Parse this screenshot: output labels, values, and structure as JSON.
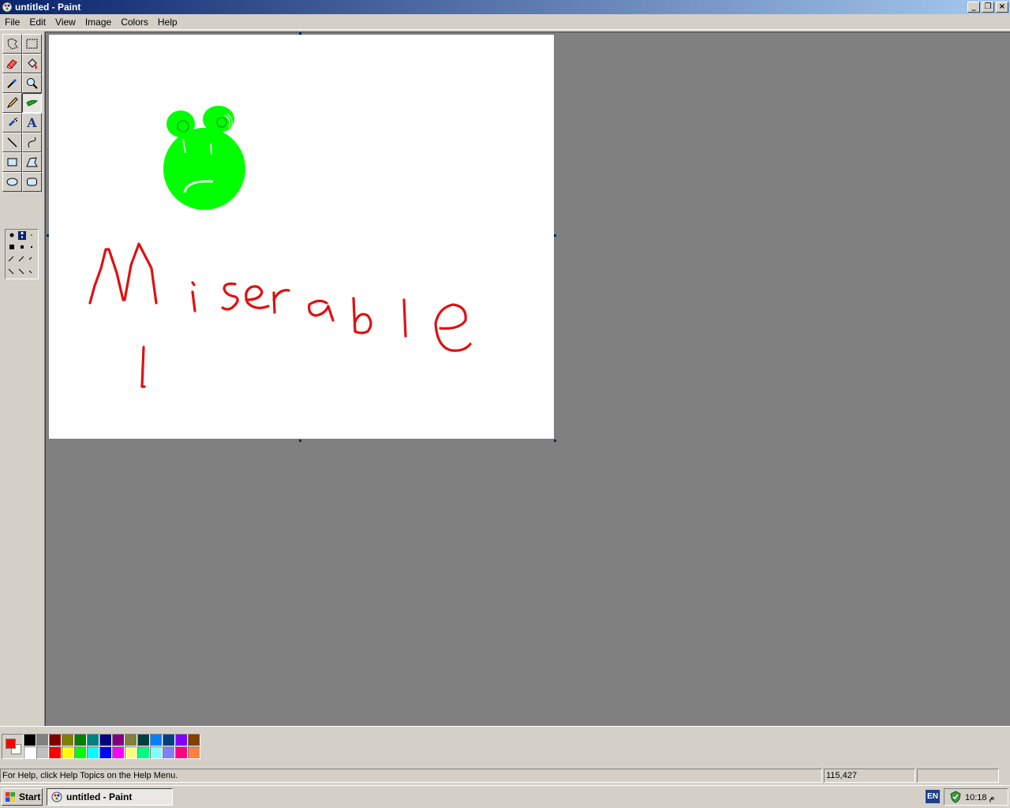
{
  "window": {
    "title": "untitled - Paint",
    "icon": "paint-icon",
    "controls": [
      "minimize-icon",
      "restore-icon",
      "close-icon"
    ],
    "control_glyphs": {
      "minimize": "_",
      "restore": "❐",
      "close": "×"
    }
  },
  "menu": [
    "File",
    "Edit",
    "View",
    "Image",
    "Colors",
    "Help"
  ],
  "tools": [
    {
      "name": "free-form-select",
      "icon": "free-select-icon"
    },
    {
      "name": "select",
      "icon": "rect-select-icon"
    },
    {
      "name": "eraser",
      "icon": "eraser-icon"
    },
    {
      "name": "fill-with-color",
      "icon": "bucket-icon"
    },
    {
      "name": "pick-color",
      "icon": "eyedropper-icon"
    },
    {
      "name": "magnifier",
      "icon": "magnifier-icon"
    },
    {
      "name": "pencil",
      "icon": "pencil-icon"
    },
    {
      "name": "brush",
      "icon": "brush-icon",
      "selected": true
    },
    {
      "name": "airbrush",
      "icon": "airbrush-icon"
    },
    {
      "name": "text",
      "icon": "text-icon",
      "glyph": "A"
    },
    {
      "name": "line",
      "icon": "line-icon"
    },
    {
      "name": "curve",
      "icon": "curve-icon"
    },
    {
      "name": "rectangle",
      "icon": "rectangle-icon"
    },
    {
      "name": "polygon",
      "icon": "polygon-icon"
    },
    {
      "name": "ellipse",
      "icon": "ellipse-icon"
    },
    {
      "name": "rounded-rectangle",
      "icon": "rounded-rect-icon"
    }
  ],
  "brush_options": {
    "shapes": [
      "round",
      "square",
      "forward-slash",
      "back-slash"
    ],
    "sizes": 3
  },
  "canvas_drawing": {
    "face_color": "#00ff00",
    "text_color": "#e01010"
  },
  "colors": {
    "foreground": "#ff0000",
    "background": "#ffffff",
    "palette_row1": [
      "#000000",
      "#808080",
      "#800000",
      "#808000",
      "#008000",
      "#008080",
      "#000080",
      "#800080",
      "#808040",
      "#004040",
      "#0080ff",
      "#004080",
      "#8000ff",
      "#804000"
    ],
    "palette_row2": [
      "#ffffff",
      "#c0c0c0",
      "#ff0000",
      "#ffff00",
      "#00ff00",
      "#00ffff",
      "#0000ff",
      "#ff00ff",
      "#ffff80",
      "#00ff80",
      "#80ffff",
      "#8080ff",
      "#ff0080",
      "#ff8040"
    ]
  },
  "status": {
    "help": "For Help, click Help Topics on the Help Menu.",
    "coords": "115,427",
    "size": ""
  },
  "taskbar": {
    "start_label": "Start",
    "task_label": "untitled - Paint",
    "language": "EN",
    "clock": "10:18 ",
    "clock_suffix": "م"
  }
}
